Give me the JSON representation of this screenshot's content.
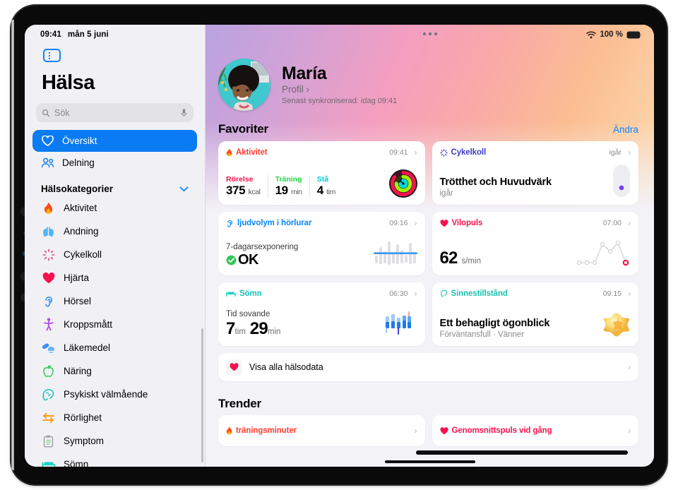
{
  "status_bar": {
    "time": "09:41",
    "date": "mån 5 juni",
    "wifi_icon": "wifi-icon",
    "battery_percent": "100 %",
    "battery_icon": "battery-full-icon"
  },
  "sidebar": {
    "toggle_icon": "sidebar-toggle-icon",
    "app_title": "Hälsa",
    "search": {
      "placeholder": "Sök",
      "icon": "search-icon",
      "mic_icon": "microphone-icon"
    },
    "nav": [
      {
        "label": "Översikt",
        "icon": "heart-icon",
        "active": true
      },
      {
        "label": "Delning",
        "icon": "people-icon",
        "active": false
      }
    ],
    "categories_header": {
      "label": "Hälsokategorier",
      "chevron_icon": "chevron-down-icon"
    },
    "categories": [
      {
        "label": "Aktivitet",
        "icon": "flame-icon",
        "glyph": "🔥"
      },
      {
        "label": "Andning",
        "icon": "lungs-icon",
        "glyph": "🫁"
      },
      {
        "label": "Cykelkoll",
        "icon": "cycle-tracking-icon",
        "glyph": "✳"
      },
      {
        "label": "Hjärta",
        "icon": "heart-icon",
        "glyph": "❤"
      },
      {
        "label": "Hörsel",
        "icon": "ear-icon",
        "glyph": "👂"
      },
      {
        "label": "Kroppsmått",
        "icon": "body-measurements-icon",
        "glyph": "🧍"
      },
      {
        "label": "Läkemedel",
        "icon": "pills-icon",
        "glyph": "💊"
      },
      {
        "label": "Näring",
        "icon": "apple-icon",
        "glyph": "🍏"
      },
      {
        "label": "Psykiskt välmående",
        "icon": "mental-wellbeing-icon",
        "glyph": "🧠"
      },
      {
        "label": "Rörlighet",
        "icon": "mobility-icon",
        "glyph": "⇄"
      },
      {
        "label": "Symptom",
        "icon": "clipboard-icon",
        "glyph": "📋"
      },
      {
        "label": "Sömn",
        "icon": "bed-icon",
        "glyph": "🛏"
      }
    ]
  },
  "main": {
    "window_handle_icon": "multitasking-dots-icon",
    "profile": {
      "avatar_icon": "user-avatar",
      "name": "María",
      "profile_link": "Profil",
      "profile_chevron": "›",
      "sync_text": "Senast synkroniserad: idag 09:41"
    },
    "favorites": {
      "title": "Favoriter",
      "edit_label": "Ändra",
      "cards": [
        {
          "id": "aktivitet",
          "title": "Aktivitet",
          "icon": "flame-icon",
          "color": "#ff3b30",
          "time": "09:41",
          "chevron": "›",
          "metrics": [
            {
              "label": "Rörelse",
              "color": "#fa114f",
              "value": "375",
              "unit": "kcal"
            },
            {
              "label": "Träning",
              "color": "#2ad544",
              "value": "19",
              "unit": "min"
            },
            {
              "label": "Stå",
              "color": "#00c7d4",
              "value": "4",
              "unit": "tim"
            }
          ],
          "visual": "activity-rings"
        },
        {
          "id": "cykelkoll",
          "title": "Cykelkoll",
          "icon": "cycle-tracking-icon",
          "color": "#3f37c9",
          "time": "igår",
          "chevron": "›",
          "headline": "Trötthet och Huvudvärk",
          "subtext": "igår",
          "visual": "cycle-pill"
        },
        {
          "id": "hoerlurar",
          "title": "ljudvolym i hörlurar",
          "icon": "ear-icon",
          "color": "#0a84ff",
          "time": "09:16",
          "chevron": "›",
          "label": "7-dagarsexponering",
          "status": "OK",
          "status_icon": "check-circle-icon",
          "visual": "audio-bars"
        },
        {
          "id": "vilopuls",
          "title": "Vilopuls",
          "icon": "heart-icon",
          "color": "#fa114f",
          "time": "07:00",
          "chevron": "›",
          "value": "62",
          "unit": "s/min",
          "visual": "line-chart"
        },
        {
          "id": "somn",
          "title": "Sömn",
          "icon": "bed-icon",
          "color": "#19d3c5",
          "time": "06:30",
          "chevron": "›",
          "label": "Tid sovande",
          "value_hours": "7",
          "unit_hours": "tim",
          "value_minutes": "29",
          "unit_minutes": "min",
          "visual": "sleep-bars"
        },
        {
          "id": "sinnestillstand",
          "title": "Sinnestillstånd",
          "icon": "mental-wellbeing-icon",
          "color": "#19c3b0",
          "time": "09:15",
          "chevron": "›",
          "headline": "Ett behagligt ögonblick",
          "subtext": "Förväntansfull · Vänner",
          "visual": "mood-star"
        }
      ]
    },
    "all_health_data": {
      "label": "Visa alla hälsodata",
      "icon": "heart-icon",
      "chevron": "›"
    },
    "trends": {
      "title": "Trender",
      "cards": [
        {
          "id": "traningsminuter",
          "title": "träningsminuter",
          "icon": "flame-icon",
          "color": "#ff3b30",
          "chevron": "›"
        },
        {
          "id": "genomsnittspuls",
          "title": "Genomsnittspuls vid gång",
          "icon": "heart-icon",
          "color": "#fa114f",
          "chevron": "›"
        }
      ]
    }
  },
  "chart_data": [
    {
      "type": "pie",
      "title": "Aktivitet — ringar",
      "categories": [
        "Rörelse",
        "Träning",
        "Stå"
      ],
      "values": [
        375,
        19,
        4
      ],
      "units": [
        "kcal",
        "min",
        "tim"
      ],
      "colors": [
        "#fa114f",
        "#a4f000",
        "#00d8e0"
      ]
    },
    {
      "type": "bar",
      "title": "ljudvolym i hörlurar — 7-dagarsexponering",
      "categories": [
        "1",
        "2",
        "3",
        "4",
        "5",
        "6",
        "7",
        "8",
        "9",
        "10",
        "11"
      ],
      "values": [
        22,
        46,
        34,
        70,
        30,
        58,
        40,
        26,
        62,
        36,
        48
      ],
      "threshold": 40,
      "threshold_color": "#3f95f5",
      "grid": false
    },
    {
      "type": "line",
      "title": "Vilopuls",
      "x": [
        "1",
        "2",
        "3",
        "4",
        "5",
        "6",
        "7"
      ],
      "values": [
        10,
        10,
        10,
        74,
        52,
        78,
        8
      ],
      "ylabel": "s/min",
      "last_point_color": "#fa114f",
      "grid": false
    },
    {
      "type": "bar",
      "title": "Sömn — tid sovande",
      "categories": [
        "1",
        "2",
        "3",
        "4",
        "5",
        "6"
      ],
      "values": [
        55,
        70,
        48,
        62,
        88,
        58
      ],
      "colors": [
        "#1f78f0",
        "#58a9f8",
        "#9ec9fb"
      ],
      "grid": false
    }
  ]
}
